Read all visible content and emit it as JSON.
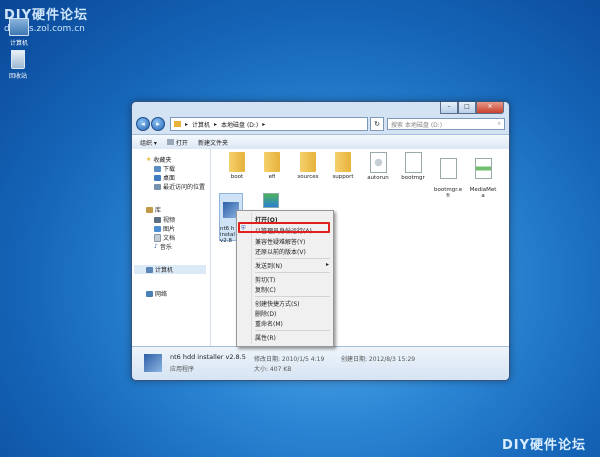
{
  "watermark": {
    "title": "DIY硬件论坛",
    "url": "diybbs.zol.com.cn",
    "bottom": "DIY硬件论坛"
  },
  "desktop": {
    "icons": [
      {
        "label": "计算机"
      },
      {
        "label": "回收站"
      }
    ]
  },
  "window": {
    "controls": {
      "minimize": "–",
      "maximize": "□",
      "close": "✕"
    },
    "address": {
      "parts": [
        "计算机",
        "本地磁盘 (D:)"
      ]
    },
    "search_placeholder": "搜索 本地磁盘 (D:)",
    "toolbar": {
      "organize": "组织 ▾",
      "open": "打开",
      "new_folder": "新建文件夹"
    },
    "sidebar": {
      "favorites": "收藏夹",
      "download": "下载",
      "desktop": "桌面",
      "recent": "最近访问的位置",
      "library": "库",
      "video": "视频",
      "pictures": "图片",
      "documents": "文档",
      "music": "音乐",
      "computer": "计算机",
      "network": "网络"
    },
    "items": [
      {
        "label": "boot",
        "type": "folder"
      },
      {
        "label": "efi",
        "type": "folder"
      },
      {
        "label": "sources",
        "type": "folder"
      },
      {
        "label": "support",
        "type": "folder"
      },
      {
        "label": "autorun",
        "type": "file"
      },
      {
        "label": "bootmgr",
        "type": "file"
      },
      {
        "label": "bootmgr.e\nfi",
        "type": "file"
      },
      {
        "label": "MediaMet\na",
        "type": "file"
      },
      {
        "label": "nt6 h\ninstal\nv2.8",
        "type": "app"
      }
    ],
    "details": {
      "name": "nt6 hdd installer v2.8.5",
      "type": "应用程序",
      "modified": "修改日期: 2010/1/5 4:19",
      "size": "大小: 407 KB",
      "created": "创建日期: 2012/8/3 15:29"
    }
  },
  "context_menu": {
    "items": [
      "打开(O)",
      "以管理员身份运行(A)",
      "兼容性疑难解答(Y)",
      "还原以前的版本(V)",
      "发送到(N)",
      "剪切(T)",
      "复制(C)",
      "创建快捷方式(S)",
      "删除(D)",
      "重命名(M)",
      "属性(R)"
    ],
    "submenu_arrow": "▸"
  },
  "colors": {
    "highlight": "#e01f1f",
    "folder": "#f0c14b",
    "accent": "#1565b8"
  }
}
